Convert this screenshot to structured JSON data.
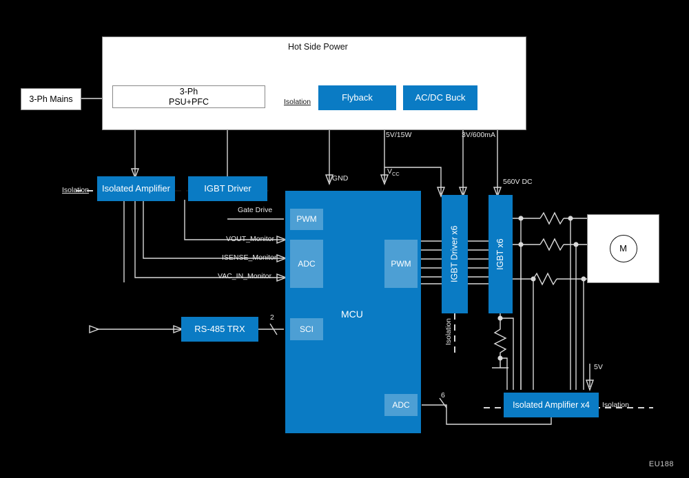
{
  "diagram": {
    "title": "Hot Side Power",
    "watermark": "EU188",
    "colors": {
      "primary": "#0a7bc4",
      "secondary": "#4d9fd4",
      "wire": "#d9d9d9",
      "background": "#000000"
    }
  },
  "blocks": {
    "mains": "3-Ph Mains",
    "psu": "3-Ph\nPSU+PFC",
    "psu_line1": "3-Ph",
    "psu_line2": "PSU+PFC",
    "flyback": "Flyback",
    "acdc_buck": "AC/DC Buck",
    "isolated_amplifier": "Isolated Amplifier",
    "igbt_driver": "IGBT Driver",
    "mcu": "MCU",
    "pwm_top": "PWM",
    "adc_left": "ADC",
    "sci": "SCI",
    "pwm_right": "PWM",
    "adc_bottom": "ADC",
    "igbt_driver_x6": "IGBT Driver x6",
    "igbt_x6": "IGBT x6",
    "rs485": "RS-485 TRX",
    "isolated_amplifier_x4": "Isolated Amplifier x4",
    "motor": "M"
  },
  "labels": {
    "isolation_power": "Isolation",
    "isolation_left": "Isolation",
    "isolation_igbt": "Isolation",
    "isolation_amp4": "Isolation",
    "rail_5v15w": "5V/15W",
    "rail_3v600ma": "3V/600mA",
    "gnd": "GND",
    "vcc": "V",
    "vcc_sub": "CC",
    "dc_bus": "560V DC",
    "gate_drive": "Gate Drive",
    "vout_monitor": "VOUT_Monitor",
    "isense_monitor": "ISENSE_Monitor",
    "vac_in_monitor": "VAC_IN_Monitor",
    "supply_5v": "5V",
    "bus_sci": "2",
    "bus_adc": "6"
  }
}
